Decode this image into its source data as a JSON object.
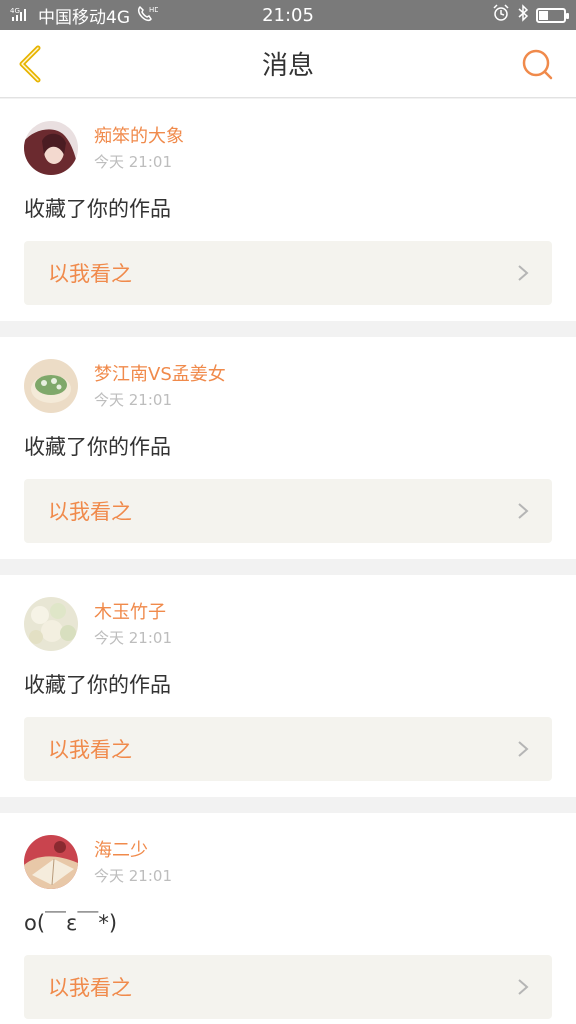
{
  "status_bar": {
    "carrier": "中国移动4G",
    "signal_label": "4G",
    "hd_label": "HD",
    "time": "21:05",
    "battery_level": 0.35
  },
  "nav": {
    "title": "消息",
    "back_icon": "chevron-left-icon",
    "search_icon": "search-icon"
  },
  "colors": {
    "accent": "#f08a4b",
    "back_icon": "#e7b400",
    "background": "#f2f2f2"
  },
  "messages": [
    {
      "username": "痴笨的大象",
      "time": "今天 21:01",
      "text": "收藏了你的作品",
      "link_label": "以我看之"
    },
    {
      "username": "梦江南VS孟姜女",
      "time": "今天 21:01",
      "text": "收藏了你的作品",
      "link_label": "以我看之"
    },
    {
      "username": "木玉竹子",
      "time": "今天 21:01",
      "text": "收藏了你的作品",
      "link_label": "以我看之"
    },
    {
      "username": "海二少",
      "time": "今天 21:01",
      "text": "o(￣ε￣*)",
      "link_label": "以我看之"
    }
  ]
}
